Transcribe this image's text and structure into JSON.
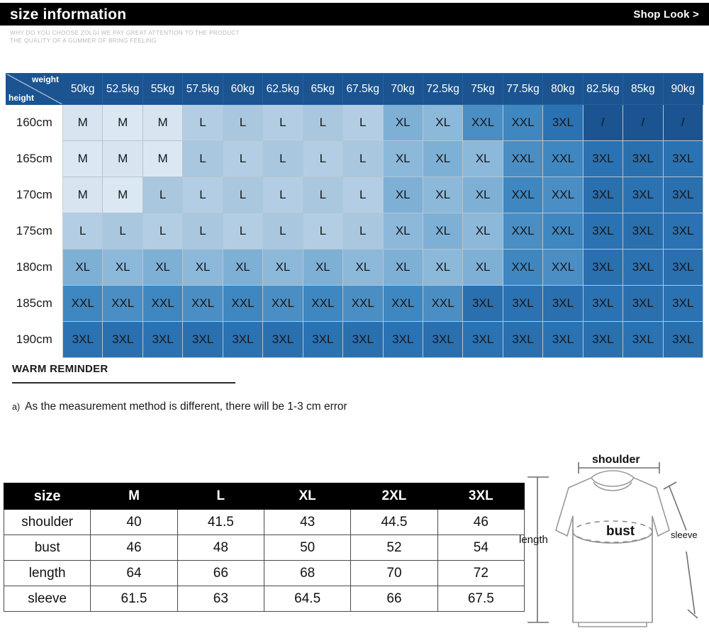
{
  "header": {
    "title": "size information",
    "shop_look": "Shop Look >",
    "subtitle": "WHY DO YOU CHOOSE ZOLGI WE PAY GREAT ATTENTION TO THE PRODUCT\nTHE QUALITY OF A GUMMER OF BRING FEELING"
  },
  "matrix": {
    "corner_weight_label": "weight",
    "corner_height_label": "height",
    "weights": [
      "50kg",
      "52.5kg",
      "55kg",
      "57.5kg",
      "60kg",
      "62.5kg",
      "65kg",
      "67.5kg",
      "70kg",
      "72.5kg",
      "75kg",
      "77.5kg",
      "80kg",
      "82.5kg",
      "85kg",
      "90kg"
    ],
    "heights": [
      "160cm",
      "165cm",
      "170cm",
      "175cm",
      "180cm",
      "185cm",
      "190cm"
    ],
    "rows": [
      {
        "height": "160cm",
        "sizes": [
          "M",
          "M",
          "M",
          "L",
          "L",
          "L",
          "L",
          "L",
          "XL",
          "XL",
          "XXL",
          "XXL",
          "3XL",
          "/",
          "/",
          "/"
        ]
      },
      {
        "height": "165cm",
        "sizes": [
          "M",
          "M",
          "M",
          "L",
          "L",
          "L",
          "L",
          "L",
          "XL",
          "XL",
          "XL",
          "XXL",
          "XXL",
          "3XL",
          "3XL",
          "3XL"
        ]
      },
      {
        "height": "170cm",
        "sizes": [
          "M",
          "M",
          "L",
          "L",
          "L",
          "L",
          "L",
          "L",
          "XL",
          "XL",
          "XL",
          "XXL",
          "XXL",
          "3XL",
          "3XL",
          "3XL"
        ]
      },
      {
        "height": "175cm",
        "sizes": [
          "L",
          "L",
          "L",
          "L",
          "L",
          "L",
          "L",
          "L",
          "XL",
          "XL",
          "XL",
          "XXL",
          "XXL",
          "3XL",
          "3XL",
          "3XL"
        ]
      },
      {
        "height": "180cm",
        "sizes": [
          "XL",
          "XL",
          "XL",
          "XL",
          "XL",
          "XL",
          "XL",
          "XL",
          "XL",
          "XL",
          "XL",
          "XXL",
          "XXL",
          "3XL",
          "3XL",
          "3XL"
        ]
      },
      {
        "height": "185cm",
        "sizes": [
          "XXL",
          "XXL",
          "XXL",
          "XXL",
          "XXL",
          "XXL",
          "XXL",
          "XXL",
          "XXL",
          "XXL",
          "3XL",
          "3XL",
          "3XL",
          "3XL",
          "3XL",
          "3XL"
        ]
      },
      {
        "height": "190cm",
        "sizes": [
          "3XL",
          "3XL",
          "3XL",
          "3XL",
          "3XL",
          "3XL",
          "3XL",
          "3XL",
          "3XL",
          "3XL",
          "3XL",
          "3XL",
          "3XL",
          "3XL",
          "3XL",
          "3XL"
        ]
      }
    ],
    "colors": {
      "header_blue": "#1b5490",
      "m": "#d8e5f0",
      "l": "#a9c8e0",
      "xl": "#7eb0d6",
      "xxl": "#4a8ec4",
      "xxxl": "#2b72b2",
      "na": "#1b5490"
    }
  },
  "warm_reminder": {
    "title": "WARM REMINDER",
    "note_marker": "a)",
    "note_text": "As the measurement method is different, there will be 1-3 cm error"
  },
  "measurements": {
    "columns": [
      "size",
      "M",
      "L",
      "XL",
      "2XL",
      "3XL"
    ],
    "rows": [
      {
        "label": "shoulder",
        "values": [
          "40",
          "41.5",
          "43",
          "44.5",
          "46"
        ]
      },
      {
        "label": "bust",
        "values": [
          "46",
          "48",
          "50",
          "52",
          "54"
        ]
      },
      {
        "label": "length",
        "values": [
          "64",
          "66",
          "68",
          "70",
          "72"
        ]
      },
      {
        "label": "sleeve",
        "values": [
          "61.5",
          "63",
          "64.5",
          "66",
          "67.5"
        ]
      }
    ]
  },
  "diagram": {
    "shoulder_label": "shoulder",
    "bust_label": "bust",
    "length_label": "length",
    "sleeve_label": "sleeve"
  }
}
